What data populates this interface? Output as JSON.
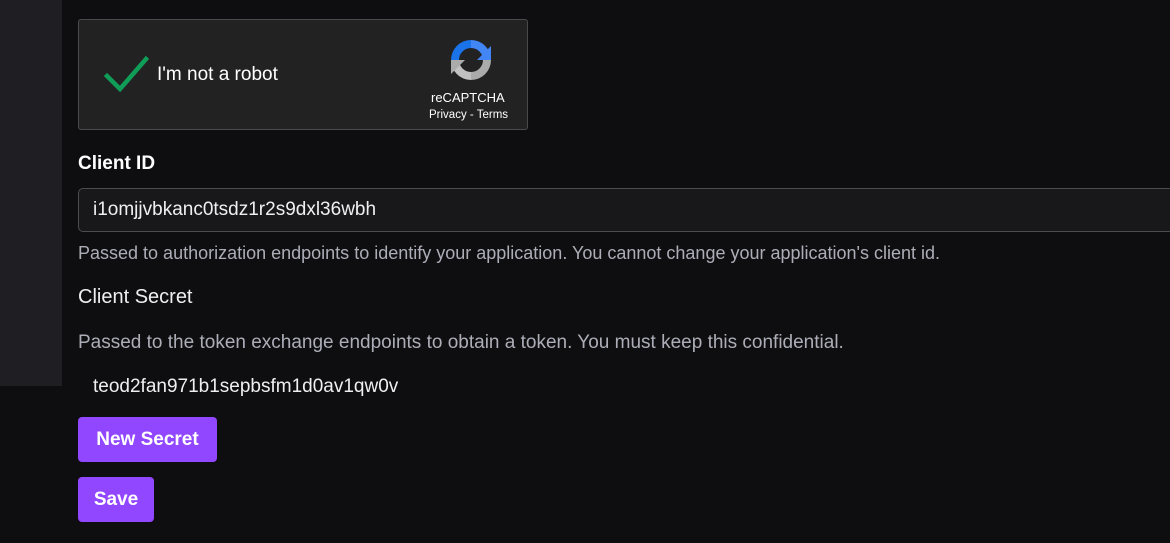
{
  "captcha": {
    "label": "I'm not a robot",
    "brand": "reCAPTCHA",
    "privacy_link": "Privacy",
    "separator": " - ",
    "terms_link": "Terms",
    "check_color": "#0f9d58"
  },
  "client_id": {
    "label": "Client ID",
    "value": "i1omjjvbkanc0tsdz1r2s9dxl36wbh",
    "help": "Passed to authorization endpoints to identify your application. You cannot change your application's client id."
  },
  "client_secret": {
    "label": "Client Secret",
    "help": "Passed to the token exchange endpoints to obtain a token. You must keep this confidential.",
    "value": "teod2fan971b1sepbsfm1d0av1qw0v"
  },
  "buttons": {
    "new_secret": "New Secret",
    "save": "Save"
  },
  "colors": {
    "accent": "#9147ff",
    "background": "#0e0e10"
  }
}
